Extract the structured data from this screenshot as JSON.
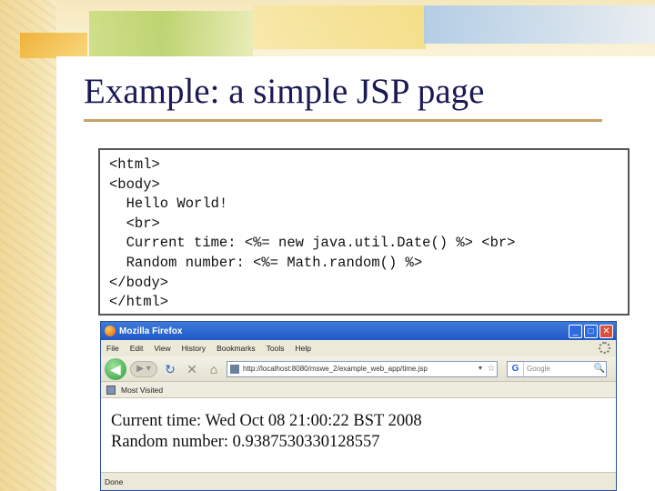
{
  "slide": {
    "title": "Example: a simple JSP page"
  },
  "code": {
    "lines": [
      "<html>",
      "<body>",
      "  Hello World!",
      "  <br>",
      "  Current time: <%= new java.util.Date() %> <br>",
      "  Random number: <%= Math.random() %>",
      "</body>",
      "</html>"
    ]
  },
  "browser": {
    "title": "Mozilla Firefox",
    "window_buttons": {
      "minimize": "_",
      "maximize": "□",
      "close": "✕"
    },
    "menu": [
      "File",
      "Edit",
      "View",
      "History",
      "Bookmarks",
      "Tools",
      "Help"
    ],
    "nav": {
      "back": "◀",
      "forward": "▶ ▾",
      "reload": "↻",
      "stop": "✕",
      "home": "⌂"
    },
    "url": "http://localhost:8080/mswe_2/example_web_app/time.jsp",
    "url_dropdown": "▼",
    "url_star": "☆",
    "search": {
      "engine": "G",
      "placeholder": "Google",
      "go": "🔍"
    },
    "bookmarks": [
      "Most Visited"
    ],
    "page": {
      "lines": [
        "Current time: Wed Oct 08 21:00:22 BST 2008",
        "Random number: 0.9387530330128557"
      ]
    },
    "status": "Done"
  },
  "colors": {
    "title": "#1a1a55",
    "title_rule": "#c7a263",
    "titlebar": "#1f58c6",
    "back_button": "#2e9a36"
  },
  "icons": {
    "firefox": "firefox-logo-icon",
    "back": "back-arrow-icon",
    "forward": "forward-arrow-icon",
    "reload": "reload-icon",
    "stop": "stop-icon",
    "home": "home-icon",
    "bookmark": "bookmark-folder-icon",
    "search": "search-icon"
  }
}
